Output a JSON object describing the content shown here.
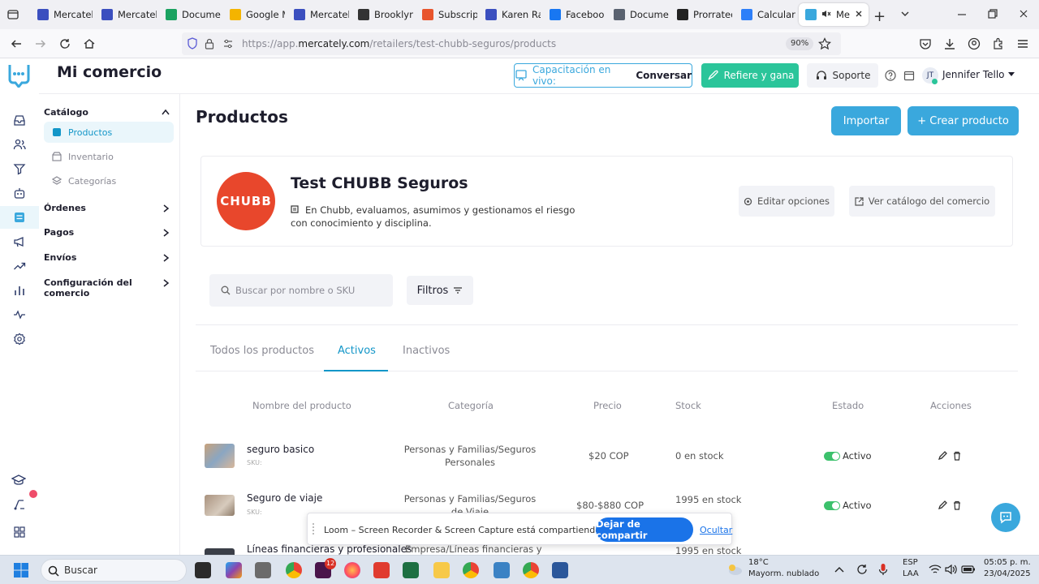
{
  "browser": {
    "tabs": [
      {
        "label": "Mercately",
        "color": "#3b4fbf"
      },
      {
        "label": "Mercately",
        "color": "#3b4fbf"
      },
      {
        "label": "Documen",
        "color": "#1aa260"
      },
      {
        "label": "Google M",
        "color": "#f4b400"
      },
      {
        "label": "Mercately",
        "color": "#3b4fbf"
      },
      {
        "label": "Brooklyn",
        "color": "#333333"
      },
      {
        "label": "Subscripti",
        "color": "#e8552d"
      },
      {
        "label": "Karen Ran",
        "color": "#3b4fbf"
      },
      {
        "label": "Facebook",
        "color": "#1877f2"
      },
      {
        "label": "Documen",
        "color": "#5a6270"
      },
      {
        "label": "Prorrateo",
        "color": "#222222"
      },
      {
        "label": "Calcular t",
        "color": "#2d7ff9"
      },
      {
        "label": "Me",
        "color": "#3aa8dd"
      }
    ],
    "url_prefix": "https://app.",
    "url_domain": "mercately.com",
    "url_path": "/retailers/test-chubb-seguros/products",
    "zoom": "90%"
  },
  "topbar": {
    "brand": "Mi comercio",
    "training_label": "Capacitación en vivo:",
    "training_action": "Conversar",
    "refer_label": "Refiere y gana",
    "support_label": "Soporte",
    "user_initials": "JT",
    "user_name": "Jennifer Tello"
  },
  "sidebar": {
    "catalog_label": "Catálogo",
    "catalog_items": [
      {
        "label": "Productos"
      },
      {
        "label": "Inventario"
      },
      {
        "label": "Categorías"
      }
    ],
    "sections": [
      {
        "label": "Órdenes"
      },
      {
        "label": "Pagos"
      },
      {
        "label": "Envíos"
      },
      {
        "label": "Configuración del comercio"
      }
    ]
  },
  "page": {
    "title": "Productos",
    "import_label": "Importar",
    "create_label": "+ Crear producto"
  },
  "store": {
    "logo_text": "CHUBB",
    "name": "Test CHUBB Seguros",
    "description": "En Chubb, evaluamos, asumimos y gestionamos el riesgo con conocimiento y disciplina.",
    "edit_label": "Editar opciones",
    "catalog_label": "Ver catálogo del comercio"
  },
  "filters": {
    "search_placeholder": "Buscar por nombre o SKU",
    "filters_label": "Filtros"
  },
  "tabs": [
    {
      "label": "Todos los productos"
    },
    {
      "label": "Activos"
    },
    {
      "label": "Inactivos"
    }
  ],
  "table": {
    "headers": [
      "Nombre del producto",
      "Categoría",
      "Precio",
      "Stock",
      "Estado",
      "Acciones"
    ],
    "rows": [
      {
        "name": "seguro basico",
        "sku": "SKU:",
        "category": "Personas y Familias/Seguros Personales",
        "price": "$20 COP",
        "stock": "0 en stock",
        "status": "Activo"
      },
      {
        "name": "Seguro de viaje",
        "sku": "SKU:",
        "category": "Personas y Familias/Seguros de Viaje",
        "price": "$80-$880 COP",
        "stock": "1995 en stock",
        "status": "Activo"
      },
      {
        "name": "Líneas financieras y profesionales",
        "sku": "",
        "category": "Empresa/Líneas financieras y",
        "price": "",
        "stock": "1995 en stock",
        "status": ""
      }
    ]
  },
  "loom_bar": {
    "message": "Loom – Screen Recorder & Screen Capture está compartiendo tu pantalla.",
    "stop_label": "Dejar de compartir",
    "hide_label": "Ocultar"
  },
  "taskbar": {
    "search_placeholder": "Buscar",
    "weather_temp": "18°C",
    "weather_desc": "Mayorm. nublado",
    "lang": "ESP",
    "lang_sub": "LAA",
    "time": "05:05 p. m.",
    "date": "23/04/2025",
    "badge_count": "12"
  },
  "colors": {
    "accent": "#3aa8dd",
    "green": "#2bc59a",
    "chubb_red": "#e8472c"
  }
}
